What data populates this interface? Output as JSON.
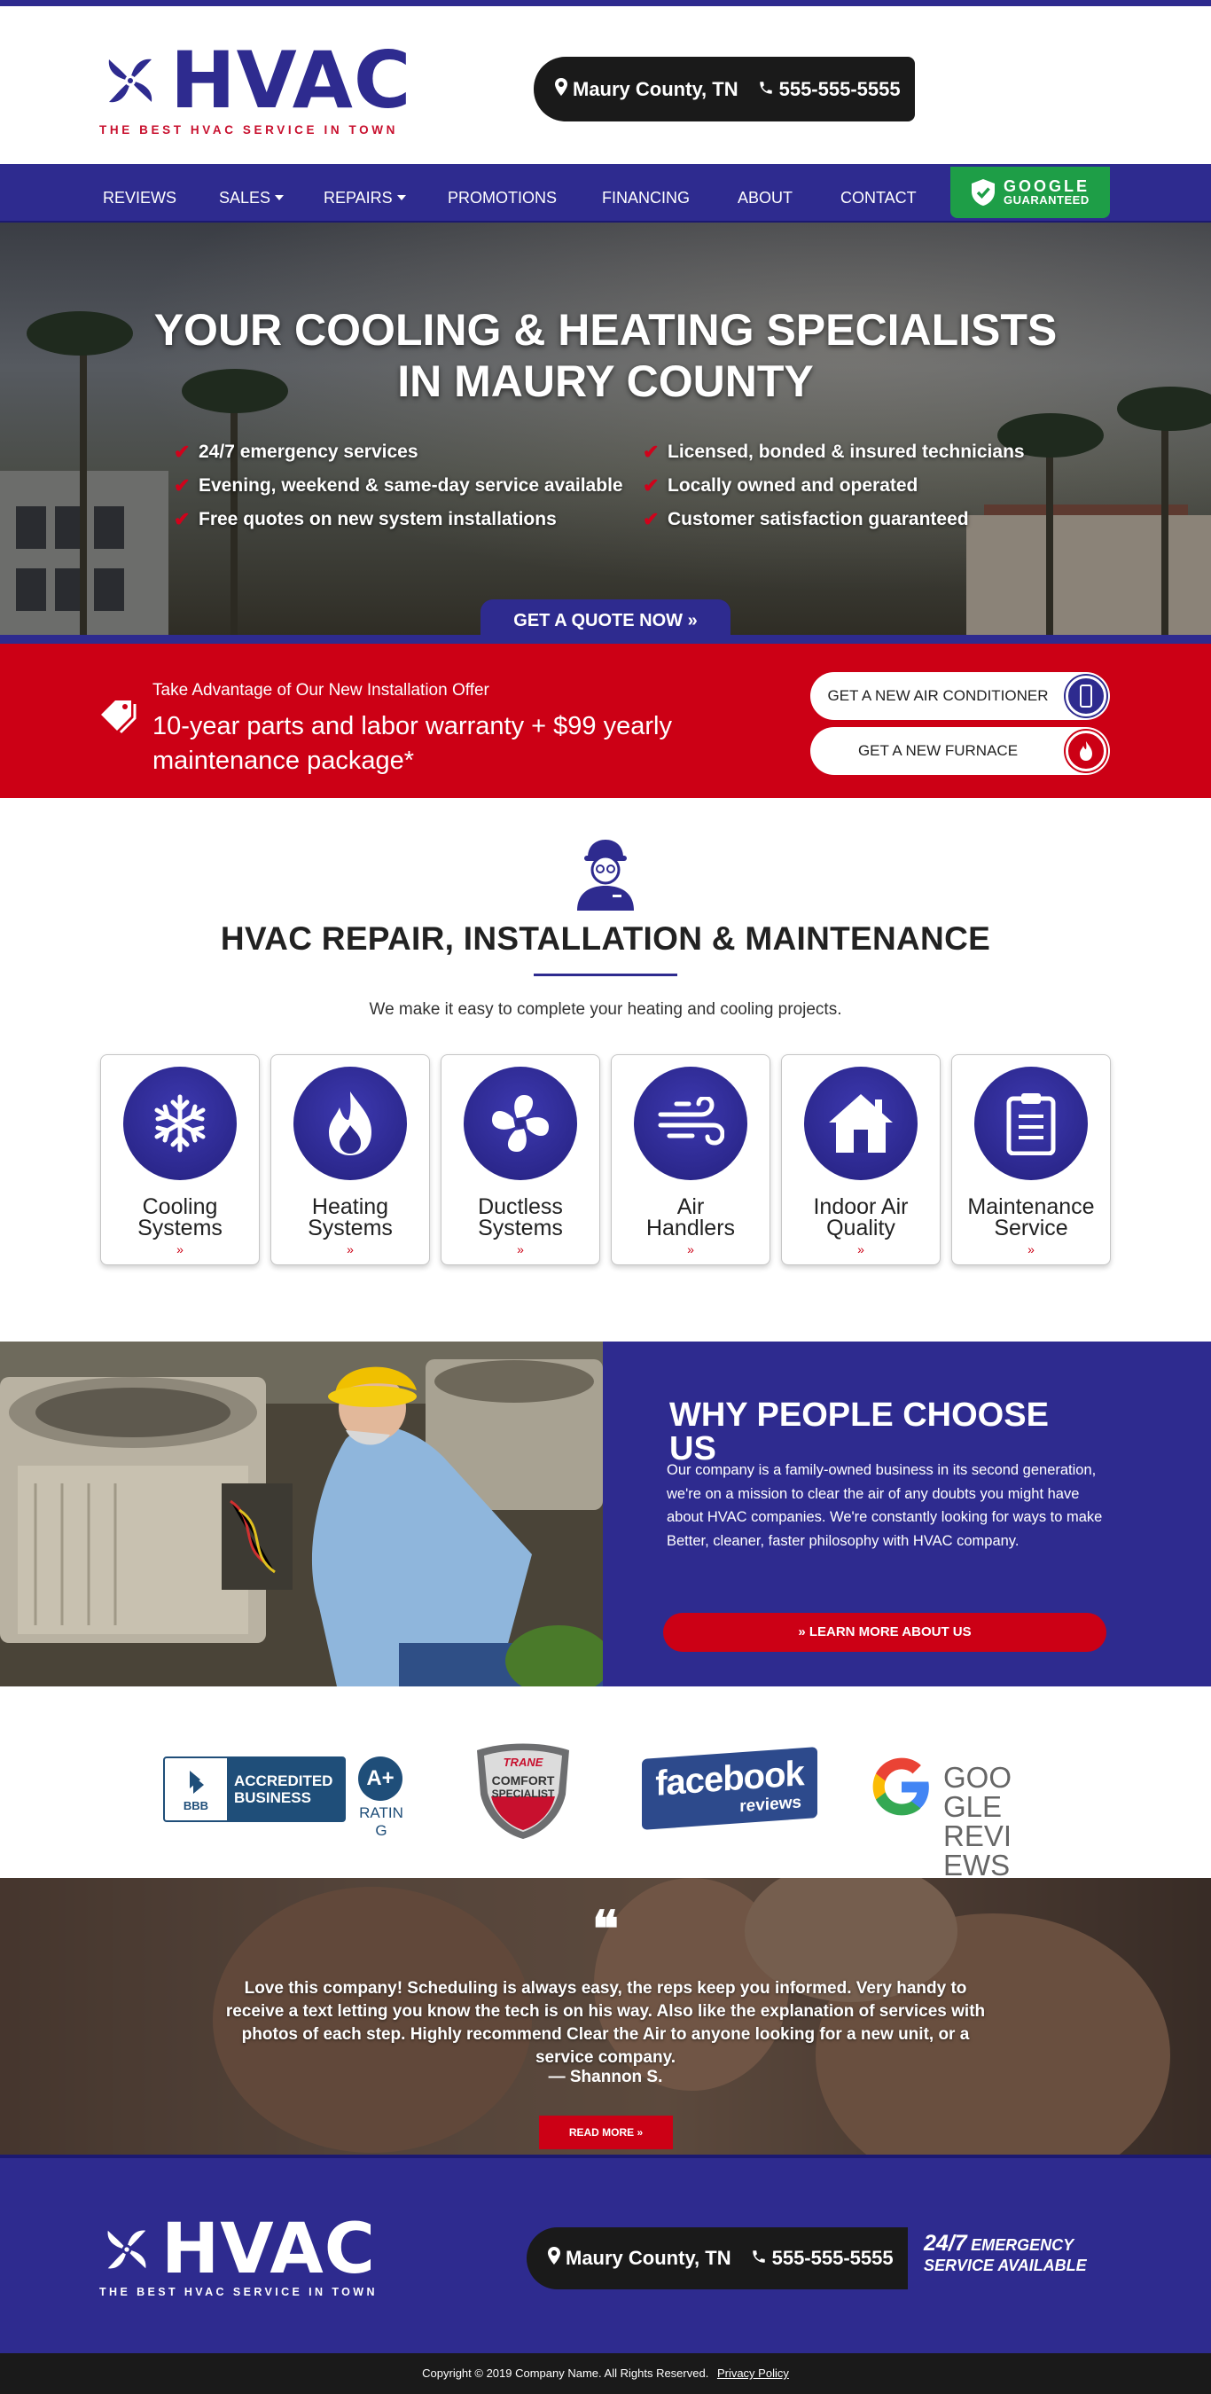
{
  "brand": {
    "name": "HVAC",
    "tagline": "THE BEST HVAC SERVICE IN TOWN",
    "primary_color": "#2e2b8f",
    "accent_color": "#cc0015",
    "dark_color": "#1a1a1a"
  },
  "header": {
    "location": "Maury County, TN",
    "phone": "555-555-5555"
  },
  "nav": {
    "items": [
      {
        "label": "REVIEWS"
      },
      {
        "label": "SALES"
      },
      {
        "label": "REPAIRS"
      },
      {
        "label": "PROMOTIONS"
      },
      {
        "label": "FINANCING"
      },
      {
        "label": "ABOUT"
      },
      {
        "label": "CONTACT"
      }
    ],
    "google_badge": {
      "line1": "GOOGLE",
      "line2": "GUARANTEED"
    }
  },
  "hero": {
    "title_line1": "YOUR COOLING & HEATING SPECIALISTS",
    "title_line2": "IN MAURY COUNTY",
    "left_list": [
      "24/7 emergency services",
      "Evening, weekend & same-day service available",
      "Free quotes on new system installations"
    ],
    "right_list": [
      "Licensed, bonded & insured technicians",
      "Locally owned and operated",
      "Customer satisfaction guaranteed"
    ],
    "cta": "GET A QUOTE NOW »"
  },
  "offer": {
    "small": "Take Advantage of Our New Installation Offer",
    "big": "10-year parts and labor warranty + $99 yearly maintenance package*",
    "btn_ac": "GET A NEW AIR CONDITIONER",
    "btn_furnace": "GET A NEW FURNACE"
  },
  "services": {
    "title": "HVAC REPAIR, INSTALLATION & MAINTENANCE",
    "subtitle": "We make it easy to complete your heating and cooling projects.",
    "cards": [
      {
        "line1": "Cooling",
        "line2": "Systems",
        "icon": "snowflake-icon"
      },
      {
        "line1": "Heating",
        "line2": "Systems",
        "icon": "flame-icon"
      },
      {
        "line1": "Ductless",
        "line2": "Systems",
        "icon": "fan-icon"
      },
      {
        "line1": "Air",
        "line2": "Handlers",
        "icon": "wind-icon"
      },
      {
        "line1": "Indoor Air",
        "line2": "Quality",
        "icon": "house-icon"
      },
      {
        "line1": "Maintenance",
        "line2": "Service",
        "icon": "clipboard-icon"
      }
    ],
    "chevron": "»"
  },
  "why": {
    "title": "WHY PEOPLE CHOOSE US",
    "text": "Our company is a family-owned business in its second generation, we're on a mission to clear the air of any doubts you might have about HVAC companies. We're constantly looking for ways to make Better, cleaner, faster philosophy with HVAC company.",
    "cta": "» LEARN MORE ABOUT US"
  },
  "badges": {
    "bbb": {
      "logo": "BBB",
      "line1": "ACCREDITED",
      "line2": "BUSINESS",
      "grade": "A+",
      "rating": "RATING"
    },
    "trane": {
      "brand": "TRANE",
      "line1": "COMFORT",
      "line2": "SPECIALIST"
    },
    "facebook": {
      "line1": "facebook",
      "line2": "reviews"
    },
    "google": {
      "text": "GOOGLE REVIEWS"
    }
  },
  "testimonial": {
    "quote_mark": "❝",
    "text": "Love this company! Scheduling is always easy, the reps keep you informed. Very handy to receive a text letting you know the tech is on his way. Also like the explanation of services with photos of each step. Highly recommend Clear the Air to anyone looking for a new unit, or a service company.",
    "author": "— Shannon S.",
    "cta": "READ MORE »"
  },
  "footer": {
    "location": "Maury County, TN",
    "phone": "555-555-5555",
    "emergency_big": "24/7",
    "emergency_small1": "EMERGENCY",
    "emergency_small2": "SERVICE AVAILABLE",
    "copyright": "Copyright © 2019 Company Name. All Rights Reserved.",
    "privacy": "Privacy Policy"
  }
}
